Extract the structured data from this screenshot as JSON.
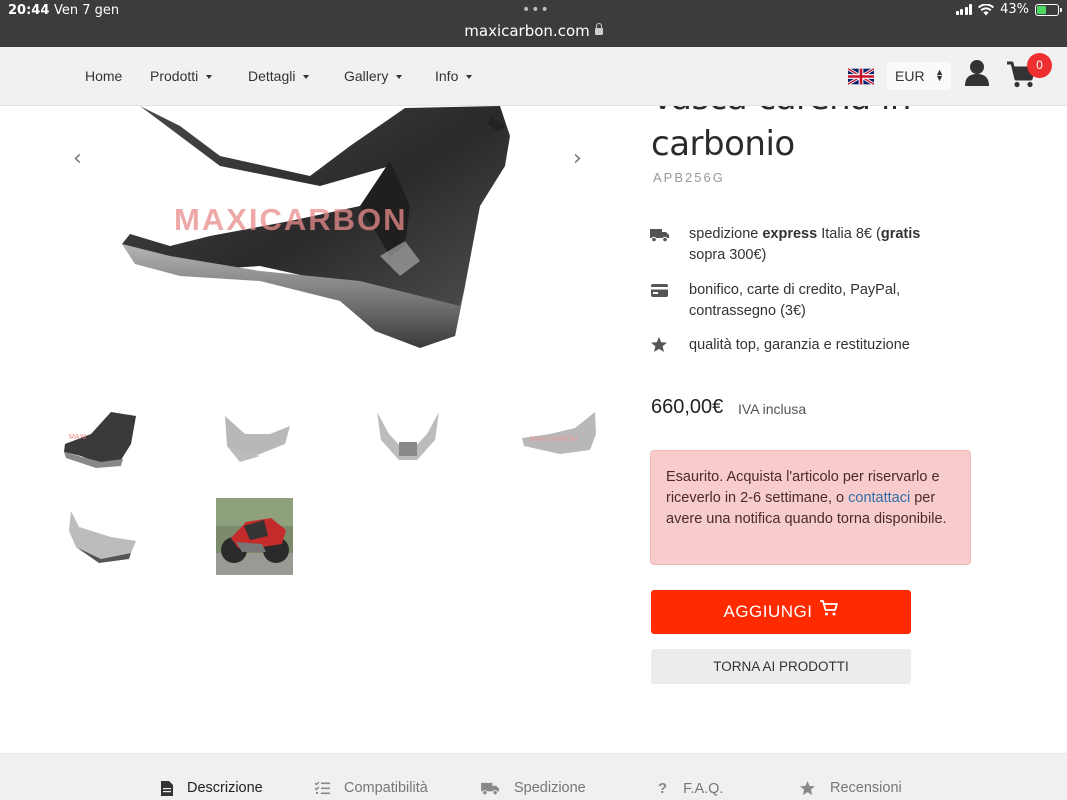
{
  "status_bar": {
    "time": "20:44",
    "date": "Ven 7 gen",
    "url": "maxicarbon.com",
    "battery": "43%"
  },
  "nav": {
    "items": [
      {
        "label": "Home"
      },
      {
        "label": "Prodotti"
      },
      {
        "label": "Dettagli"
      },
      {
        "label": "Gallery"
      },
      {
        "label": "Info"
      }
    ],
    "currency": "EUR",
    "cart_count": "0"
  },
  "product": {
    "title_line1": "Vasca carena in",
    "title_line2": "carbonio",
    "sku": "APB256G",
    "watermark": "MAXICARBON",
    "features": {
      "shipping_pre": "spedizione ",
      "shipping_bold": "express",
      "shipping_mid": " Italia 8€ (",
      "shipping_bold2": "gratis",
      "shipping_post": " sopra 300€)",
      "payment": "bonifico, carte di credito, PayPal, contrassegno (3€)",
      "quality": "qualità top, garanzia e restituzione"
    },
    "price": "660,00€",
    "price_note": "IVA inclusa",
    "alert_pre": "Esaurito. Acquista l'articolo per riservarlo e riceverlo in 2-6 settimane, o ",
    "alert_link": "contattaci",
    "alert_post": " per avere una notifica quando torna disponibile.",
    "add_button": "AGGIUNGI",
    "back_button": "TORNA AI PRODOTTI"
  },
  "tabs": [
    {
      "label": "Descrizione"
    },
    {
      "label": "Compatibilità"
    },
    {
      "label": "Spedizione"
    },
    {
      "label": "F.A.Q."
    },
    {
      "label": "Recensioni"
    }
  ],
  "colors": {
    "accent": "#ff2a00",
    "badge": "#ee2f2f",
    "alert_bg": "#f8cccc",
    "link": "#2f6ea8"
  }
}
